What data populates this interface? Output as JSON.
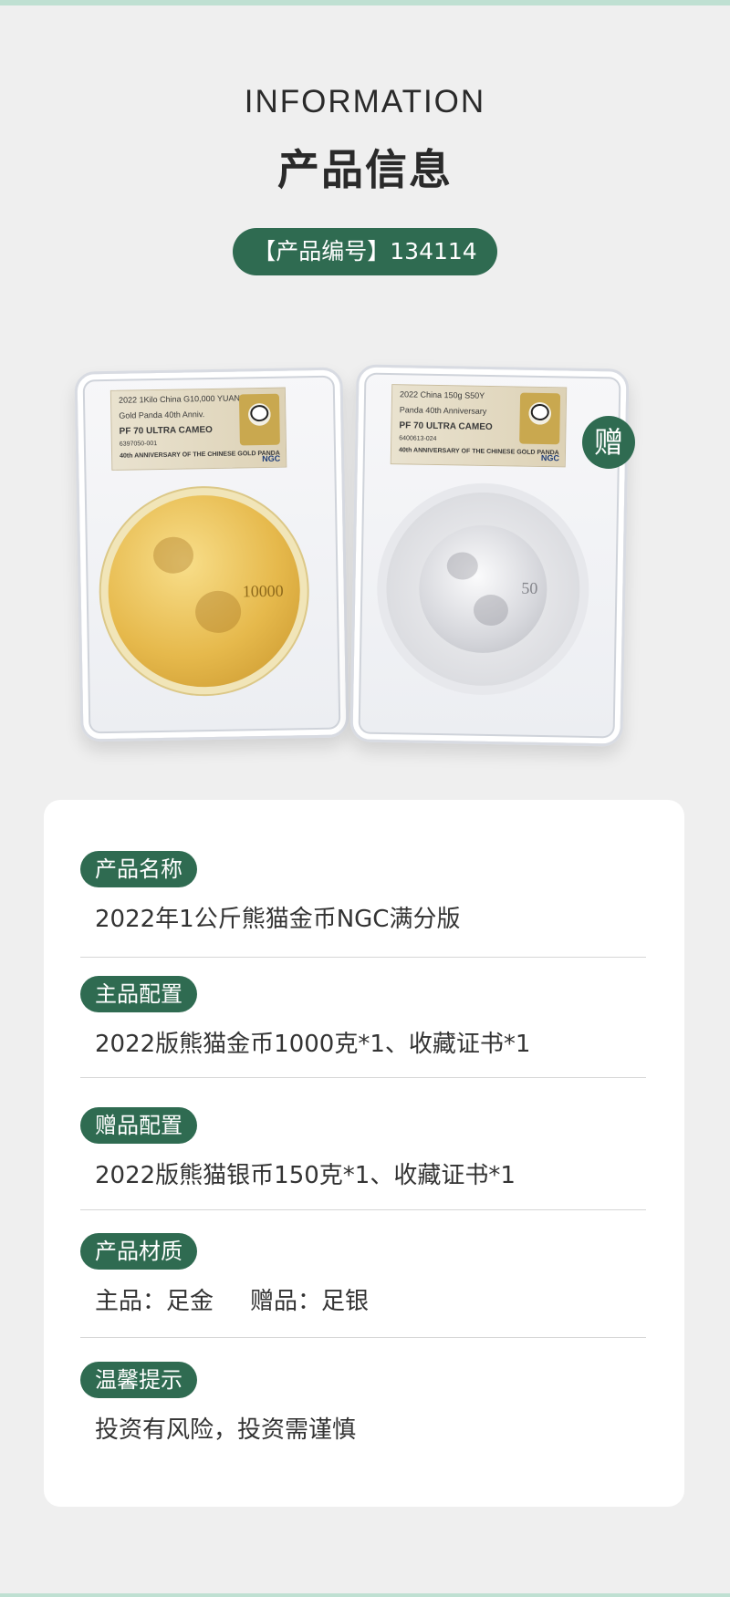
{
  "header": {
    "title_en": "INFORMATION",
    "title_cn": "产品信息",
    "product_code_label": "【产品编号】",
    "product_code": "134114"
  },
  "images": {
    "gold_slab": {
      "label_line1": "2022 1Kilo China G10,000 YUAN",
      "label_line2": "Gold Panda 40th Anniv.",
      "label_grade": "PF 70 ULTRA CAMEO",
      "label_cert": "6397050-001",
      "label_footer": "40th ANNIVERSARY OF THE CHINESE GOLD PANDA",
      "coin_denomination": "10000",
      "grader": "NGC"
    },
    "silver_slab": {
      "label_line1": "2022 China 150g S50Y",
      "label_line2": "Panda 40th Anniversary",
      "label_grade": "PF 70 ULTRA CAMEO",
      "label_cert": "6400613-024",
      "label_footer": "40th ANNIVERSARY OF THE CHINESE GOLD PANDA",
      "coin_denomination": "50",
      "grader": "NGC"
    },
    "gift_badge": "赠"
  },
  "info": [
    {
      "tag": "产品名称",
      "value": "2022年1公斤熊猫金币NGC满分版"
    },
    {
      "tag": "主品配置",
      "value": "2022版熊猫金币1000克*1、收藏证书*1"
    },
    {
      "tag": "赠品配置",
      "value": "2022版熊猫银币150克*1、收藏证书*1"
    },
    {
      "tag": "产品材质",
      "value_main": "主品：足金",
      "value_gift": "赠品：足银"
    },
    {
      "tag": "温馨提示",
      "value": "投资有风险，投资需谨慎"
    }
  ],
  "colors": {
    "brand_green": "#2f6b51",
    "background": "#efefef",
    "accent_stripe": "#bfe0d2"
  }
}
